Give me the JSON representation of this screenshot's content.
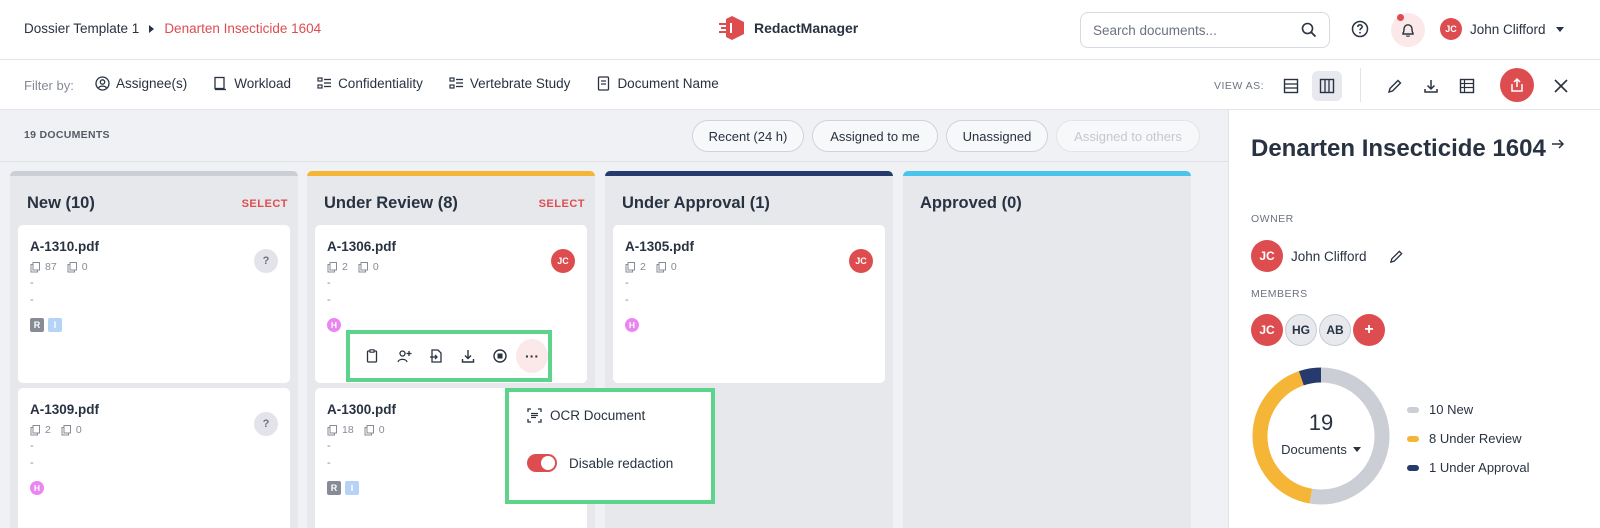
{
  "breadcrumb": {
    "template": "Dossier Template 1",
    "dossier": "Denarten Insecticide 1604"
  },
  "brand": {
    "name": "RedactManager",
    "color": "#dd4d50"
  },
  "search": {
    "placeholder": "Search documents..."
  },
  "user": {
    "initials": "JC",
    "name": "John Clifford"
  },
  "filters": {
    "label": "Filter by:",
    "items": [
      "Assignee(s)",
      "Workload",
      "Confidentiality",
      "Vertebrate Study",
      "Document Name"
    ]
  },
  "view": {
    "label": "VIEW AS:"
  },
  "main": {
    "doc_count": "19 DOCUMENTS",
    "quick_filters": [
      "Recent (24 h)",
      "Assigned to me",
      "Unassigned",
      "Assigned to others"
    ]
  },
  "columns": [
    {
      "title": "New (10)",
      "select": "SELECT",
      "color": "#cbced4"
    },
    {
      "title": "Under Review (8)",
      "select": "SELECT",
      "color": "#f5b637"
    },
    {
      "title": "Under Approval (1)",
      "color": "#273a6d"
    },
    {
      "title": "Approved (0)",
      "color": "#4ac4ec"
    }
  ],
  "cards": {
    "c1310": {
      "name": "A-1310.pdf",
      "pages": "87",
      "annotations": "0",
      "dash": "-",
      "status": "?",
      "tags": [
        "R",
        "I"
      ]
    },
    "c1309": {
      "name": "A-1309.pdf",
      "pages": "2",
      "annotations": "0",
      "dash": "-",
      "status": "?",
      "tag": "H"
    },
    "c1306": {
      "name": "A-1306.pdf",
      "pages": "2",
      "annotations": "0",
      "dash": "-",
      "assignee": "JC",
      "tag": "H"
    },
    "c1300": {
      "name": "A-1300.pdf",
      "pages": "18",
      "annotations": "0",
      "dash": "-",
      "tags": [
        "R",
        "I"
      ]
    },
    "c1305": {
      "name": "A-1305.pdf",
      "pages": "2",
      "annotations": "0",
      "dash": "-",
      "assignee": "JC",
      "tag": "H"
    }
  },
  "action_menu": {
    "ocr": "OCR Document",
    "disable_redaction": "Disable redaction",
    "more": "···"
  },
  "panel": {
    "title": "Denarten Insecticide 1604",
    "owner_label": "OWNER",
    "owner": {
      "initials": "JC",
      "name": "John Clifford"
    },
    "members_label": "MEMBERS",
    "members": [
      "JC",
      "HG",
      "AB"
    ],
    "add_member": "+",
    "total": "19",
    "total_label": "Documents",
    "legend": [
      {
        "label": "10 New",
        "value": 10,
        "color": "#cbced4"
      },
      {
        "label": "8 Under Review",
        "value": 8,
        "color": "#f5b637"
      },
      {
        "label": "1 Under Approval",
        "value": 1,
        "color": "#273a6d"
      }
    ]
  }
}
